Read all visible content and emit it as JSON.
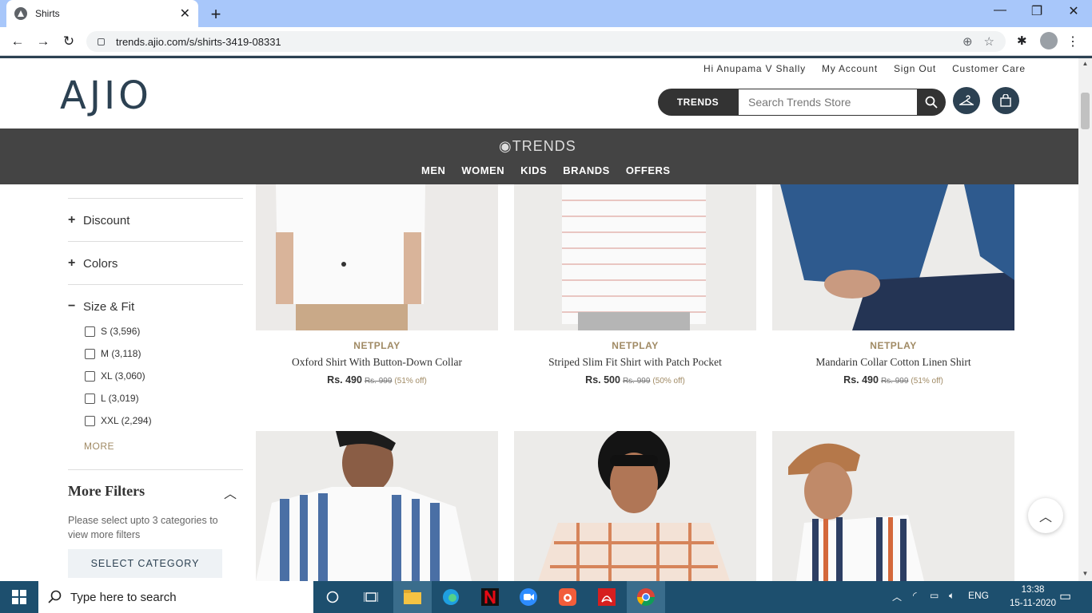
{
  "browser": {
    "tab_title": "Shirts",
    "url": "trends.ajio.com/s/shirts-3419-08331"
  },
  "header": {
    "greeting": "Hi Anupama V Shally",
    "my_account": "My Account",
    "sign_out": "Sign Out",
    "customer_care": "Customer Care",
    "logo": "AJIO",
    "trends_button": "TRENDS",
    "search_placeholder": "Search Trends Store"
  },
  "nav": {
    "logo": "TRENDS",
    "links": [
      "MEN",
      "WOMEN",
      "KIDS",
      "BRANDS",
      "OFFERS"
    ]
  },
  "sidebar": {
    "facets": [
      {
        "sign": "+",
        "label": "Discount"
      },
      {
        "sign": "+",
        "label": "Colors"
      },
      {
        "sign": "−",
        "label": "Size & Fit"
      }
    ],
    "size_options": [
      "S (3,596)",
      "M (3,118)",
      "XL (3,060)",
      "L (3,019)",
      "XXL (2,294)"
    ],
    "more": "MORE",
    "more_filters_title": "More Filters",
    "more_filters_note": "Please select upto 3 categories to view more filters",
    "select_category": "SELECT CATEGORY"
  },
  "products": [
    {
      "brand": "NETPLAY",
      "name": "Oxford Shirt With Button-Down Collar",
      "price": "Rs. 490",
      "mrp": "Rs. 999",
      "discount": "(51% off)"
    },
    {
      "brand": "NETPLAY",
      "name": "Striped Slim Fit Shirt with Patch Pocket",
      "price": "Rs. 500",
      "mrp": "Rs. 999",
      "discount": "(50% off)"
    },
    {
      "brand": "NETPLAY",
      "name": "Mandarin Collar Cotton Linen Shirt",
      "price": "Rs. 490",
      "mrp": "Rs. 999",
      "discount": "(51% off)"
    }
  ],
  "taskbar": {
    "search_placeholder": "Type here to search",
    "language": "ENG",
    "time": "13:38",
    "date": "15-11-2020"
  }
}
